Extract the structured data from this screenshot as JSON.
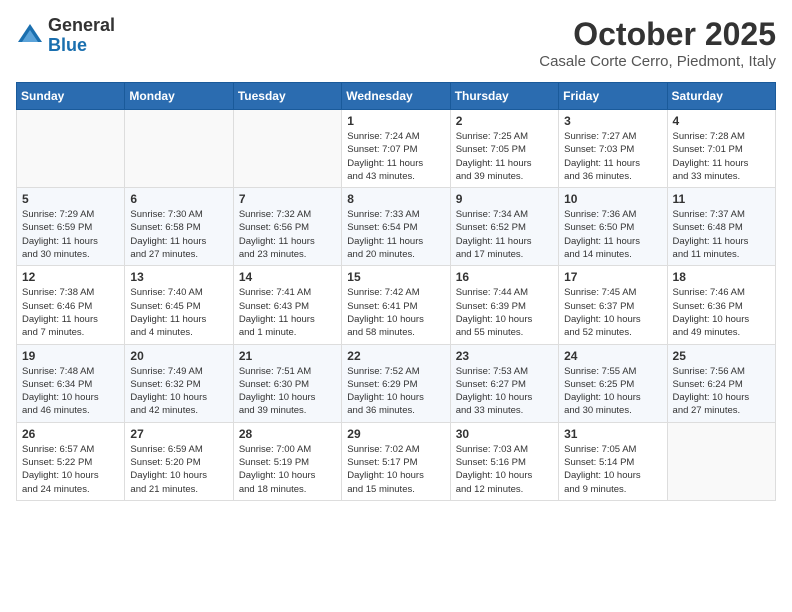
{
  "header": {
    "logo_general": "General",
    "logo_blue": "Blue",
    "month_title": "October 2025",
    "location": "Casale Corte Cerro, Piedmont, Italy"
  },
  "days_of_week": [
    "Sunday",
    "Monday",
    "Tuesday",
    "Wednesday",
    "Thursday",
    "Friday",
    "Saturday"
  ],
  "weeks": [
    [
      {
        "day": "",
        "info": ""
      },
      {
        "day": "",
        "info": ""
      },
      {
        "day": "",
        "info": ""
      },
      {
        "day": "1",
        "info": "Sunrise: 7:24 AM\nSunset: 7:07 PM\nDaylight: 11 hours\nand 43 minutes."
      },
      {
        "day": "2",
        "info": "Sunrise: 7:25 AM\nSunset: 7:05 PM\nDaylight: 11 hours\nand 39 minutes."
      },
      {
        "day": "3",
        "info": "Sunrise: 7:27 AM\nSunset: 7:03 PM\nDaylight: 11 hours\nand 36 minutes."
      },
      {
        "day": "4",
        "info": "Sunrise: 7:28 AM\nSunset: 7:01 PM\nDaylight: 11 hours\nand 33 minutes."
      }
    ],
    [
      {
        "day": "5",
        "info": "Sunrise: 7:29 AM\nSunset: 6:59 PM\nDaylight: 11 hours\nand 30 minutes."
      },
      {
        "day": "6",
        "info": "Sunrise: 7:30 AM\nSunset: 6:58 PM\nDaylight: 11 hours\nand 27 minutes."
      },
      {
        "day": "7",
        "info": "Sunrise: 7:32 AM\nSunset: 6:56 PM\nDaylight: 11 hours\nand 23 minutes."
      },
      {
        "day": "8",
        "info": "Sunrise: 7:33 AM\nSunset: 6:54 PM\nDaylight: 11 hours\nand 20 minutes."
      },
      {
        "day": "9",
        "info": "Sunrise: 7:34 AM\nSunset: 6:52 PM\nDaylight: 11 hours\nand 17 minutes."
      },
      {
        "day": "10",
        "info": "Sunrise: 7:36 AM\nSunset: 6:50 PM\nDaylight: 11 hours\nand 14 minutes."
      },
      {
        "day": "11",
        "info": "Sunrise: 7:37 AM\nSunset: 6:48 PM\nDaylight: 11 hours\nand 11 minutes."
      }
    ],
    [
      {
        "day": "12",
        "info": "Sunrise: 7:38 AM\nSunset: 6:46 PM\nDaylight: 11 hours\nand 7 minutes."
      },
      {
        "day": "13",
        "info": "Sunrise: 7:40 AM\nSunset: 6:45 PM\nDaylight: 11 hours\nand 4 minutes."
      },
      {
        "day": "14",
        "info": "Sunrise: 7:41 AM\nSunset: 6:43 PM\nDaylight: 11 hours\nand 1 minute."
      },
      {
        "day": "15",
        "info": "Sunrise: 7:42 AM\nSunset: 6:41 PM\nDaylight: 10 hours\nand 58 minutes."
      },
      {
        "day": "16",
        "info": "Sunrise: 7:44 AM\nSunset: 6:39 PM\nDaylight: 10 hours\nand 55 minutes."
      },
      {
        "day": "17",
        "info": "Sunrise: 7:45 AM\nSunset: 6:37 PM\nDaylight: 10 hours\nand 52 minutes."
      },
      {
        "day": "18",
        "info": "Sunrise: 7:46 AM\nSunset: 6:36 PM\nDaylight: 10 hours\nand 49 minutes."
      }
    ],
    [
      {
        "day": "19",
        "info": "Sunrise: 7:48 AM\nSunset: 6:34 PM\nDaylight: 10 hours\nand 46 minutes."
      },
      {
        "day": "20",
        "info": "Sunrise: 7:49 AM\nSunset: 6:32 PM\nDaylight: 10 hours\nand 42 minutes."
      },
      {
        "day": "21",
        "info": "Sunrise: 7:51 AM\nSunset: 6:30 PM\nDaylight: 10 hours\nand 39 minutes."
      },
      {
        "day": "22",
        "info": "Sunrise: 7:52 AM\nSunset: 6:29 PM\nDaylight: 10 hours\nand 36 minutes."
      },
      {
        "day": "23",
        "info": "Sunrise: 7:53 AM\nSunset: 6:27 PM\nDaylight: 10 hours\nand 33 minutes."
      },
      {
        "day": "24",
        "info": "Sunrise: 7:55 AM\nSunset: 6:25 PM\nDaylight: 10 hours\nand 30 minutes."
      },
      {
        "day": "25",
        "info": "Sunrise: 7:56 AM\nSunset: 6:24 PM\nDaylight: 10 hours\nand 27 minutes."
      }
    ],
    [
      {
        "day": "26",
        "info": "Sunrise: 6:57 AM\nSunset: 5:22 PM\nDaylight: 10 hours\nand 24 minutes."
      },
      {
        "day": "27",
        "info": "Sunrise: 6:59 AM\nSunset: 5:20 PM\nDaylight: 10 hours\nand 21 minutes."
      },
      {
        "day": "28",
        "info": "Sunrise: 7:00 AM\nSunset: 5:19 PM\nDaylight: 10 hours\nand 18 minutes."
      },
      {
        "day": "29",
        "info": "Sunrise: 7:02 AM\nSunset: 5:17 PM\nDaylight: 10 hours\nand 15 minutes."
      },
      {
        "day": "30",
        "info": "Sunrise: 7:03 AM\nSunset: 5:16 PM\nDaylight: 10 hours\nand 12 minutes."
      },
      {
        "day": "31",
        "info": "Sunrise: 7:05 AM\nSunset: 5:14 PM\nDaylight: 10 hours\nand 9 minutes."
      },
      {
        "day": "",
        "info": ""
      }
    ]
  ]
}
